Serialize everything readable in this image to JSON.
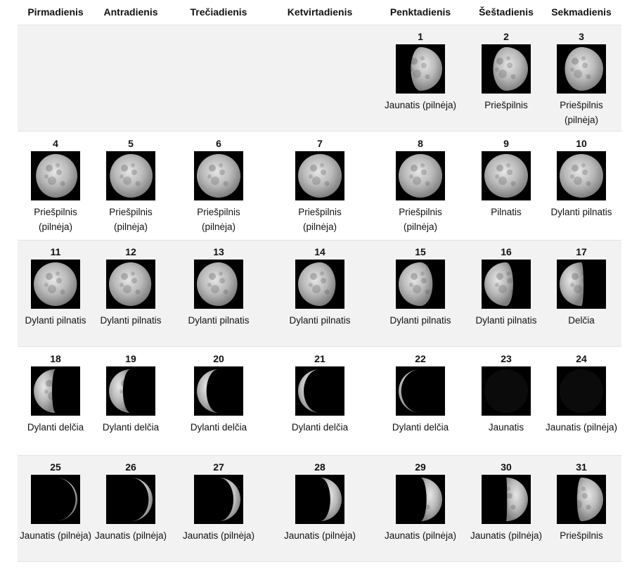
{
  "weekdays": [
    "Pirmadienis",
    "Antradienis",
    "Trečiadienis",
    "Ketvirtadienis",
    "Penktadienis",
    "Šeštadienis",
    "Sekmadienis"
  ],
  "weeks": [
    [
      null,
      null,
      null,
      null,
      {
        "day": "1",
        "phase": "Jaunatis (pilnėja)",
        "lit": 0.72,
        "side": "right"
      },
      {
        "day": "2",
        "phase": "Priešpilnis",
        "lit": 0.8,
        "side": "right"
      },
      {
        "day": "3",
        "phase": "Priešpilnis (pilnėja)",
        "lit": 0.88,
        "side": "right"
      }
    ],
    [
      {
        "day": "4",
        "phase": "Priešpilnis (pilnėja)",
        "lit": 0.95,
        "side": "right"
      },
      {
        "day": "5",
        "phase": "Priešpilnis (pilnėja)",
        "lit": 0.98,
        "side": "right"
      },
      {
        "day": "6",
        "phase": "Priešpilnis (pilnėja)",
        "lit": 1.0,
        "side": "right"
      },
      {
        "day": "7",
        "phase": "Priešpilnis (pilnėja)",
        "lit": 1.0,
        "side": "right"
      },
      {
        "day": "8",
        "phase": "Priešpilnis (pilnėja)",
        "lit": 1.0,
        "side": "right"
      },
      {
        "day": "9",
        "phase": "Pilnatis",
        "lit": 1.0,
        "side": "right"
      },
      {
        "day": "10",
        "phase": "Dylanti pilnatis",
        "lit": 1.0,
        "side": "left"
      }
    ],
    [
      {
        "day": "11",
        "phase": "Dylanti pilnatis",
        "lit": 0.99,
        "side": "left"
      },
      {
        "day": "12",
        "phase": "Dylanti pilnatis",
        "lit": 0.97,
        "side": "left"
      },
      {
        "day": "13",
        "phase": "Dylanti pilnatis",
        "lit": 0.93,
        "side": "left"
      },
      {
        "day": "14",
        "phase": "Dylanti pilnatis",
        "lit": 0.86,
        "side": "left"
      },
      {
        "day": "15",
        "phase": "Dylanti pilnatis",
        "lit": 0.78,
        "side": "left"
      },
      {
        "day": "16",
        "phase": "Dylanti pilnatis",
        "lit": 0.66,
        "side": "left"
      },
      {
        "day": "17",
        "phase": "Delčia",
        "lit": 0.55,
        "side": "left"
      }
    ],
    [
      {
        "day": "18",
        "phase": "Dylanti delčia",
        "lit": 0.42,
        "side": "left"
      },
      {
        "day": "19",
        "phase": "Dylanti delčia",
        "lit": 0.32,
        "side": "left"
      },
      {
        "day": "20",
        "phase": "Dylanti delčia",
        "lit": 0.22,
        "side": "left"
      },
      {
        "day": "21",
        "phase": "Dylanti delčia",
        "lit": 0.13,
        "side": "left"
      },
      {
        "day": "22",
        "phase": "Dylanti delčia",
        "lit": 0.06,
        "side": "left"
      },
      {
        "day": "23",
        "phase": "Jaunatis",
        "lit": 0.0,
        "side": "left"
      },
      {
        "day": "24",
        "phase": "Jaunatis (pilnėja)",
        "lit": 0.0,
        "side": "right"
      }
    ],
    [
      {
        "day": "25",
        "phase": "Jaunatis (pilnėja)",
        "lit": 0.04,
        "side": "right"
      },
      {
        "day": "26",
        "phase": "Jaunatis (pilnėja)",
        "lit": 0.09,
        "side": "right"
      },
      {
        "day": "27",
        "phase": "Jaunatis (pilnėja)",
        "lit": 0.16,
        "side": "right"
      },
      {
        "day": "28",
        "phase": "Jaunatis (pilnėja)",
        "lit": 0.26,
        "side": "right"
      },
      {
        "day": "29",
        "phase": "Jaunatis (pilnėja)",
        "lit": 0.36,
        "side": "right"
      },
      {
        "day": "30",
        "phase": "Jaunatis (pilnėja)",
        "lit": 0.48,
        "side": "right"
      },
      {
        "day": "31",
        "phase": "Priešpilnis",
        "lit": 0.6,
        "side": "right"
      }
    ]
  ]
}
